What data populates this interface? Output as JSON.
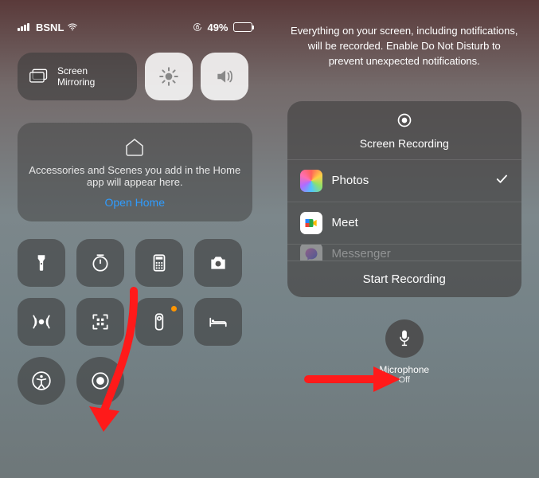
{
  "status": {
    "carrier": "BSNL",
    "battery_pct": "49%"
  },
  "controls": {
    "mirror_label": "Screen\nMirroring"
  },
  "home_pane": {
    "text": "Accessories and Scenes you add in the Home app will appear here.",
    "link": "Open Home"
  },
  "right": {
    "top_message": "Everything on your screen, including notifications, will be recorded. Enable Do Not Disturb to prevent unexpected notifications.",
    "panel_title": "Screen Recording",
    "apps": [
      {
        "name": "Photos",
        "selected": true
      },
      {
        "name": "Meet",
        "selected": false
      },
      {
        "name": "Messenger",
        "selected": false
      }
    ],
    "start_label": "Start Recording",
    "mic_label": "Microphone",
    "mic_state": "Off"
  }
}
